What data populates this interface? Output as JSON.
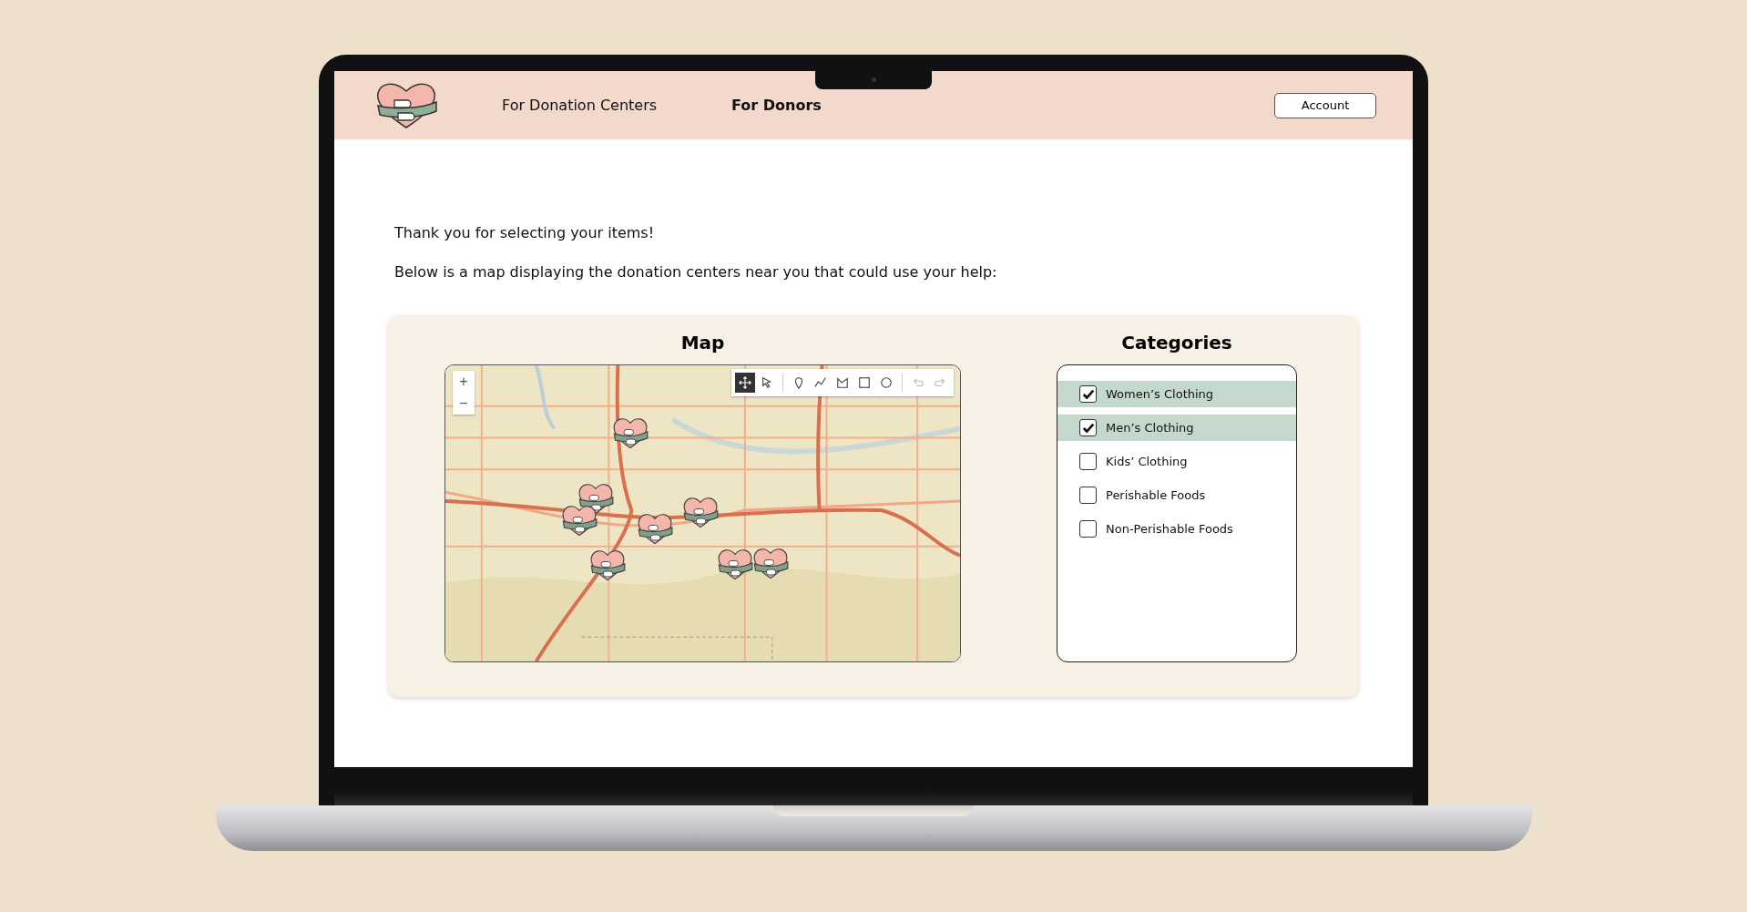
{
  "nav": {
    "links": [
      {
        "label": "For Donation Centers",
        "selected": false
      },
      {
        "label": "For Donors",
        "selected": true
      }
    ],
    "account_button": "Account"
  },
  "intro": [
    "Thank you for selecting your items!",
    "Below is a map displaying the donation centers near you that could use your help:"
  ],
  "map": {
    "title": "Map",
    "zoom_in": "+",
    "zoom_out": "−",
    "tools": [
      {
        "kind": "pan",
        "selected": true,
        "disabled": false
      },
      {
        "kind": "select",
        "selected": false,
        "disabled": false
      },
      {
        "kind": "point",
        "selected": false,
        "disabled": false
      },
      {
        "kind": "polyline",
        "selected": false,
        "disabled": false
      },
      {
        "kind": "polygon",
        "selected": false,
        "disabled": false
      },
      {
        "kind": "rectangle",
        "selected": false,
        "disabled": false
      },
      {
        "kind": "circle",
        "selected": false,
        "disabled": false
      },
      {
        "kind": "undo",
        "selected": false,
        "disabled": true
      },
      {
        "kind": "redo",
        "selected": false,
        "disabled": true
      }
    ]
  },
  "categories": {
    "title": "Categories",
    "items": [
      {
        "label": "Women’s Clothing",
        "checked": true
      },
      {
        "label": "Men’s Clothing",
        "checked": true
      },
      {
        "label": "Kids’ Clothing",
        "checked": false
      },
      {
        "label": "Perishable Foods",
        "checked": false
      },
      {
        "label": "Non-Perishable Foods",
        "checked": false
      }
    ]
  }
}
